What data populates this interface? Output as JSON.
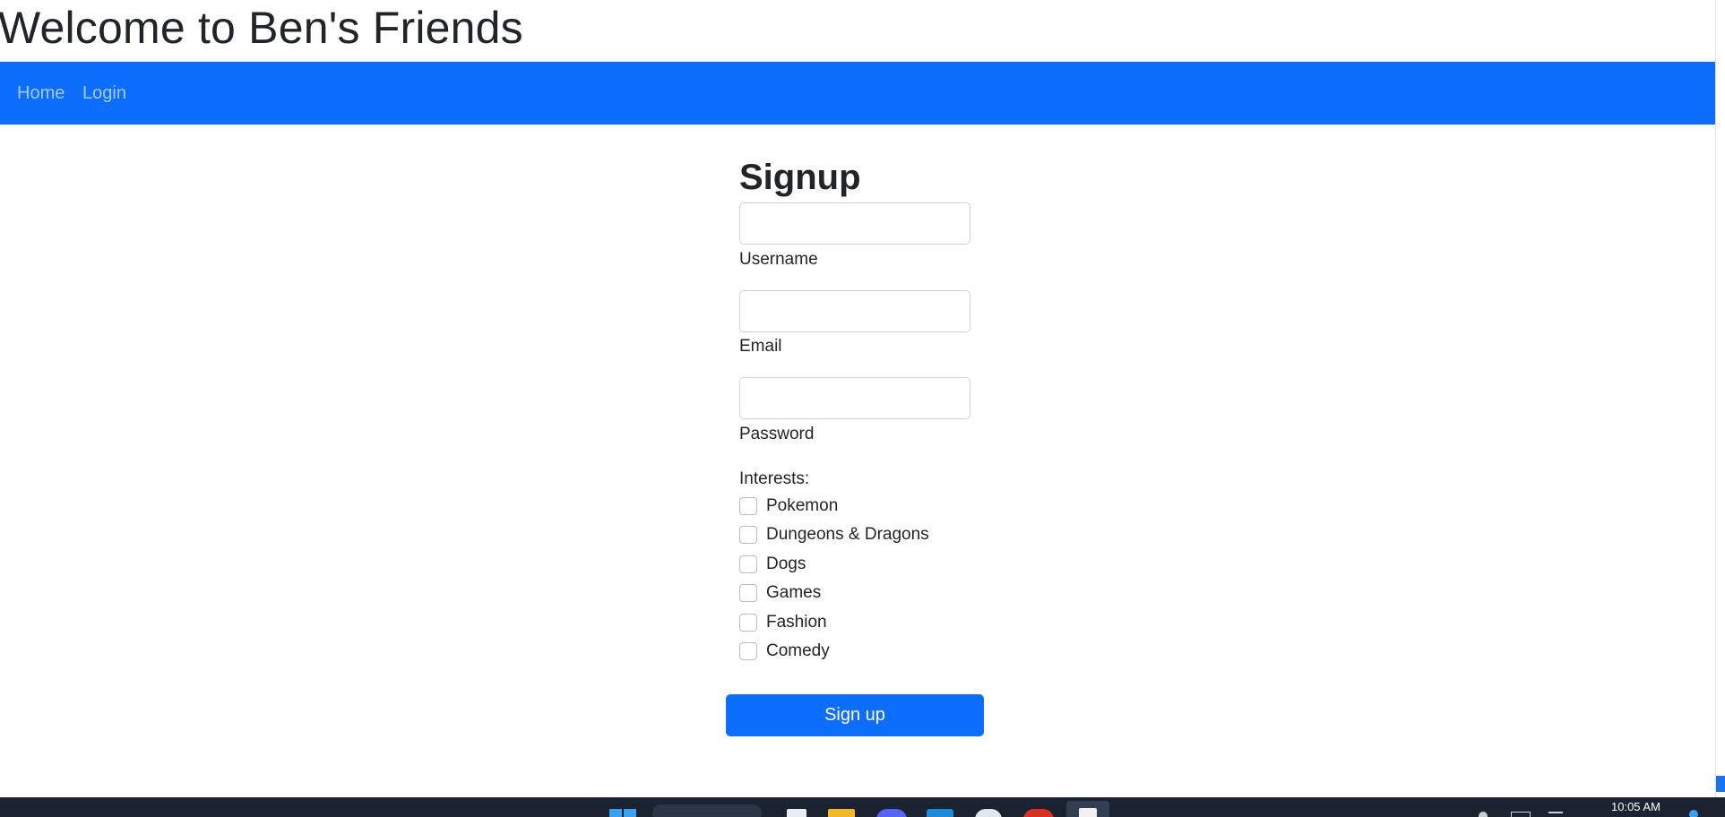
{
  "header": {
    "title": "Welcome to Ben's Friends"
  },
  "nav": {
    "home": "Home",
    "login": "Login"
  },
  "form": {
    "title": "Signup",
    "fields": {
      "username": {
        "label": "Username",
        "value": ""
      },
      "email": {
        "label": "Email",
        "value": ""
      },
      "password": {
        "label": "Password",
        "value": ""
      }
    },
    "interests_label": "Interests:",
    "interests": [
      "Pokemon",
      "Dungeons & Dragons",
      "Dogs",
      "Games",
      "Fashion",
      "Comedy"
    ],
    "submit_label": "Sign up"
  },
  "colors": {
    "primary": "#0d6efd"
  },
  "taskbar": {
    "time": "10:05 AM"
  }
}
